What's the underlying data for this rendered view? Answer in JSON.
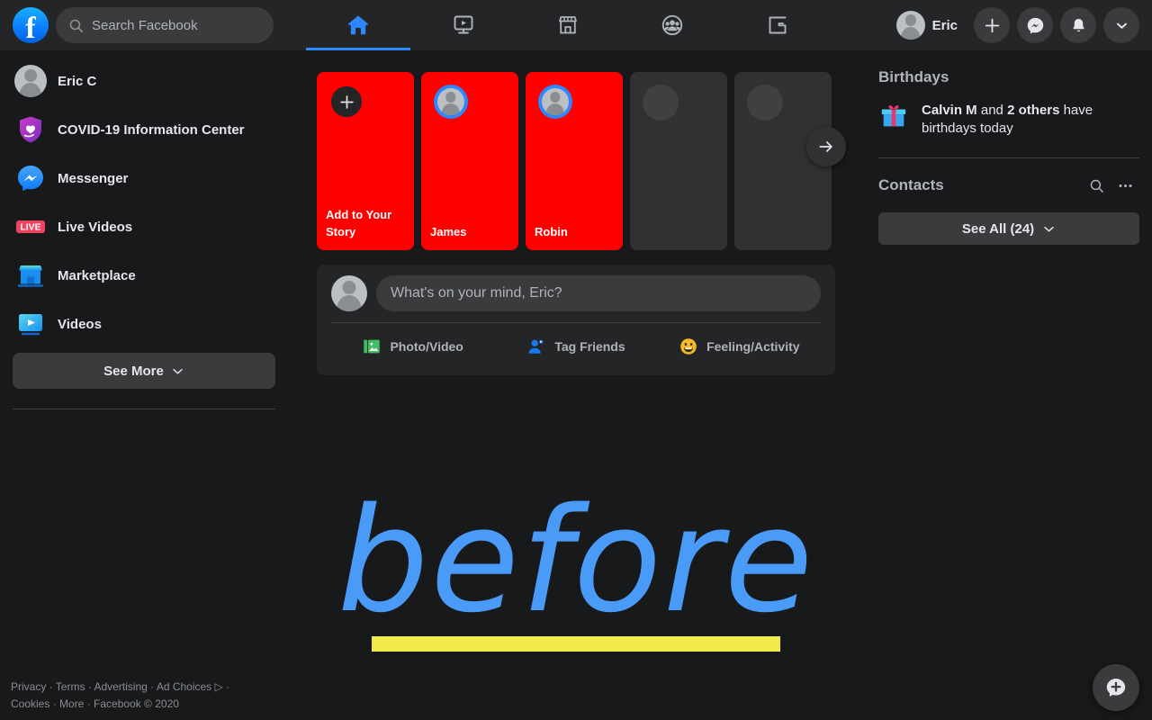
{
  "header": {
    "logo": "facebook-logo",
    "search": {
      "placeholder": "Search Facebook",
      "icon": "search-icon"
    },
    "nav": [
      {
        "name": "home",
        "icon": "home-icon",
        "active": true
      },
      {
        "name": "watch",
        "icon": "watch-icon",
        "active": false
      },
      {
        "name": "marketplace",
        "icon": "marketplace-icon",
        "active": false
      },
      {
        "name": "groups",
        "icon": "groups-icon",
        "active": false
      },
      {
        "name": "gaming",
        "icon": "gaming-icon",
        "active": false
      }
    ],
    "account_name": "Eric",
    "actions": [
      {
        "name": "create",
        "icon": "plus-icon"
      },
      {
        "name": "messenger",
        "icon": "messenger-icon"
      },
      {
        "name": "notifications",
        "icon": "bell-icon"
      },
      {
        "name": "account-menu",
        "icon": "chevron-down-icon"
      }
    ]
  },
  "sidebar": {
    "items": [
      {
        "label": "Eric C",
        "icon": "user-avatar-icon"
      },
      {
        "label": "COVID-19 Information Center",
        "icon": "covid-shield-icon"
      },
      {
        "label": "Messenger",
        "icon": "messenger-icon"
      },
      {
        "label": "Live Videos",
        "icon": "live-badge-icon"
      },
      {
        "label": "Marketplace",
        "icon": "marketplace-store-icon"
      },
      {
        "label": "Videos",
        "icon": "video-player-icon"
      }
    ],
    "see_more_label": "See More"
  },
  "stories": {
    "items": [
      {
        "label": "Add to Your Story",
        "type": "add",
        "bg": "#FF0000"
      },
      {
        "label": "James",
        "type": "story",
        "bg": "#FF0000"
      },
      {
        "label": "Robin",
        "type": "story",
        "bg": "#FF0000"
      },
      {
        "label": "",
        "type": "placeholder",
        "bg": "#303132"
      },
      {
        "label": "",
        "type": "placeholder",
        "bg": "#303132"
      }
    ],
    "next_icon": "arrow-right-icon"
  },
  "composer": {
    "placeholder": "What's on your mind, Eric?",
    "actions": [
      {
        "label": "Photo/Video",
        "icon": "photo-video-icon",
        "color": "#45BD62"
      },
      {
        "label": "Tag Friends",
        "icon": "tag-friends-icon",
        "color": "#1877F2"
      },
      {
        "label": "Feeling/Activity",
        "icon": "feeling-activity-icon",
        "color": "#F7B928"
      }
    ]
  },
  "rightbar": {
    "birthdays_title": "Birthdays",
    "birthday_icon": "gift-icon",
    "birthday_name": "Calvin M",
    "birthday_middle": " and ",
    "birthday_others": "2 others",
    "birthday_tail": " have birthdays today",
    "contacts_title": "Contacts",
    "contacts_search_icon": "search-icon",
    "contacts_more_icon": "ellipsis-icon",
    "see_all_label": "See All (24)"
  },
  "overlay": {
    "word": "before",
    "word_color": "#4A9BF7",
    "bar_color": "#F2E94B"
  },
  "footer": {
    "links": [
      "Privacy",
      "Terms",
      "Advertising",
      "Ad Choices",
      "Cookies",
      "More"
    ],
    "line1": "Privacy · Terms · Advertising · Ad Choices ▷ ·",
    "line2": "Cookies · More · Facebook © 2020"
  },
  "fab": {
    "icon": "new-message-icon"
  }
}
